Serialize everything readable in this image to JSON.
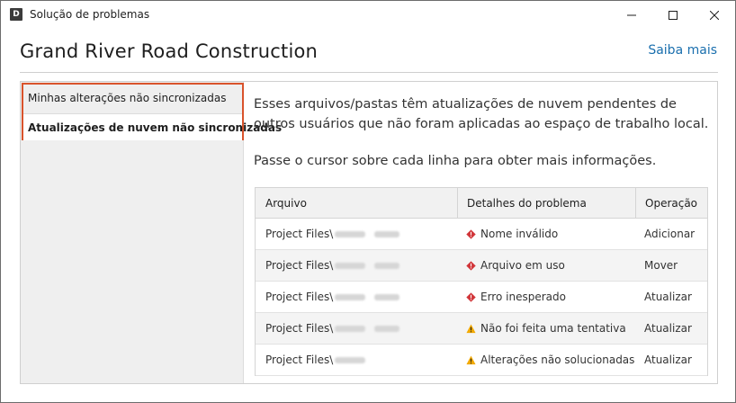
{
  "window": {
    "title": "Solução de problemas",
    "icon_letter": "D",
    "controls": [
      "minimize-icon",
      "maximize-icon",
      "close-icon"
    ]
  },
  "header": {
    "title": "Grand River Road Construction",
    "learn_more": "Saiba mais"
  },
  "sidebar": {
    "items": [
      {
        "label": "Minhas alterações não sincronizadas",
        "selected": false
      },
      {
        "label": "Atualizações de nuvem não sincronizadas",
        "selected": true
      }
    ],
    "highlight_color": "#d9532c"
  },
  "main": {
    "description": "Esses arquivos/pastas têm atualizações de nuvem pendentes de outros usuários que não foram aplicadas ao espaço de trabalho local.",
    "hint": "Passe o cursor sobre cada linha para obter mais informações."
  },
  "table": {
    "columns": [
      "Arquivo",
      "Detalhes do problema",
      "Operação"
    ],
    "rows": [
      {
        "file": "Project Files\\",
        "detail": "Nome inválido",
        "severity": "error",
        "operation": "Adicionar"
      },
      {
        "file": "Project Files\\",
        "detail": "Arquivo em uso",
        "severity": "error",
        "operation": "Mover"
      },
      {
        "file": "Project Files\\",
        "detail": "Erro inesperado",
        "severity": "error",
        "operation": "Atualizar"
      },
      {
        "file": "Project Files\\",
        "detail": "Não foi feita uma tentativa",
        "severity": "warning",
        "operation": "Atualizar"
      },
      {
        "file": "Project Files\\",
        "detail": "Alterações não solucionadas",
        "severity": "warning",
        "operation": "Atualizar"
      }
    ]
  },
  "colors": {
    "error": "#d13438",
    "warning": "#f2a900",
    "link": "#1a6fae"
  }
}
